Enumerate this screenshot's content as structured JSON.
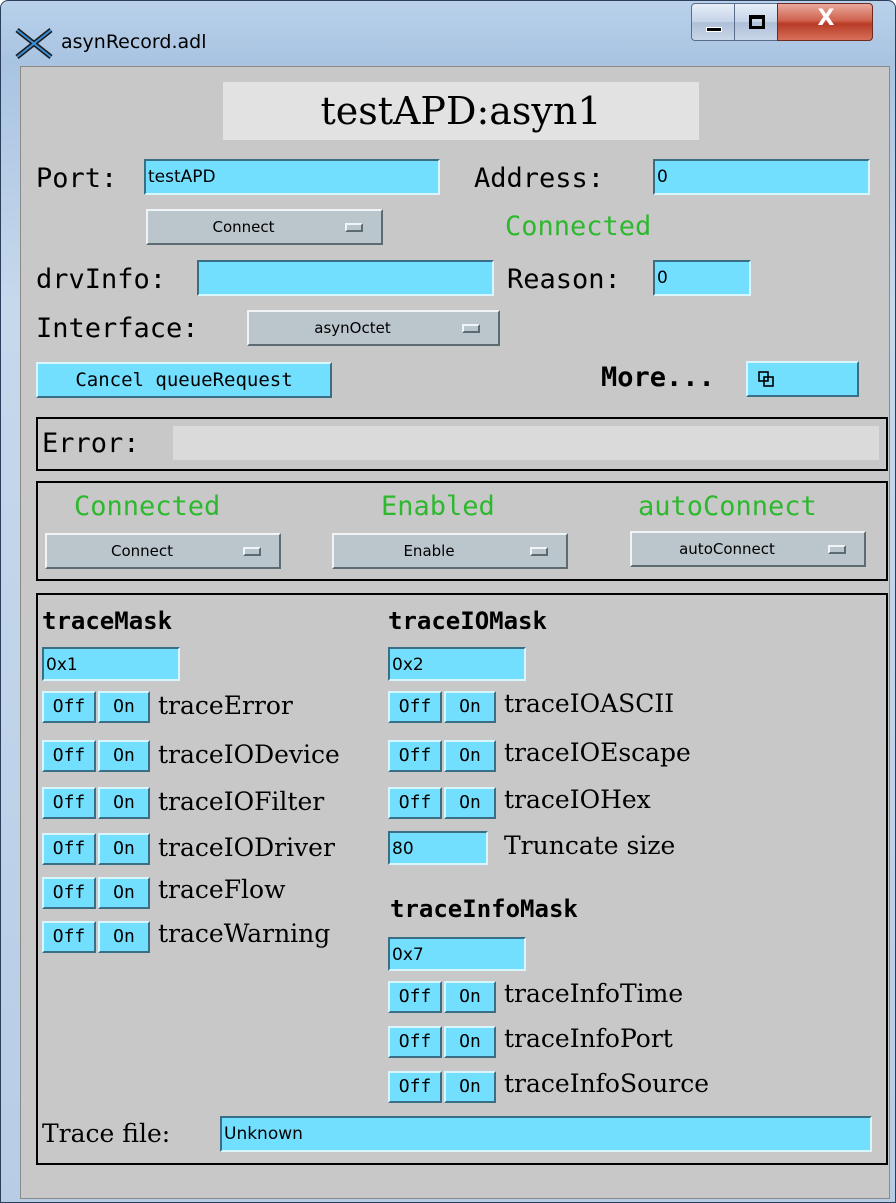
{
  "window": {
    "title": "asynRecord.adl",
    "close_glyph": "X",
    "colors": {
      "field": "#73dfff",
      "background": "#c8c8c8",
      "status_green": "#2eb82e",
      "menu": "#bac6cc"
    }
  },
  "record": {
    "name": "testAPD:asyn1"
  },
  "port": {
    "label": "Port:",
    "value": "testAPD"
  },
  "address": {
    "label": "Address:",
    "value": "0"
  },
  "connect_menu": {
    "value": "Connect"
  },
  "connection_status": "Connected",
  "drvinfo": {
    "label": "drvInfo:",
    "value": ""
  },
  "reason": {
    "label": "Reason:",
    "value": "0"
  },
  "interface": {
    "label": "Interface:",
    "value": "asynOctet"
  },
  "cancel_button": "Cancel queueRequest",
  "more": {
    "label": "More...",
    "icon": "related-display-icon"
  },
  "error": {
    "label": "Error:",
    "value": ""
  },
  "status_panel": {
    "connected": {
      "status": "Connected",
      "menu": "Connect"
    },
    "enabled": {
      "status": "Enabled",
      "menu": "Enable"
    },
    "autoconnect": {
      "status": "autoConnect",
      "menu": "autoConnect"
    }
  },
  "trace_mask": {
    "header": "traceMask",
    "value": "0x1",
    "items": [
      {
        "off": "Off",
        "on": "On",
        "label": "traceError"
      },
      {
        "off": "Off",
        "on": "On",
        "label": "traceIODevice"
      },
      {
        "off": "Off",
        "on": "On",
        "label": "traceIOFilter"
      },
      {
        "off": "Off",
        "on": "On",
        "label": "traceIODriver"
      },
      {
        "off": "Off",
        "on": "On",
        "label": "traceFlow"
      },
      {
        "off": "Off",
        "on": "On",
        "label": "traceWarning"
      }
    ]
  },
  "trace_io_mask": {
    "header": "traceIOMask",
    "value": "0x2",
    "items": [
      {
        "off": "Off",
        "on": "On",
        "label": "traceIOASCII"
      },
      {
        "off": "Off",
        "on": "On",
        "label": "traceIOEscape"
      },
      {
        "off": "Off",
        "on": "On",
        "label": "traceIOHex"
      }
    ],
    "truncate": {
      "value": "80",
      "label": "Truncate size"
    }
  },
  "trace_info_mask": {
    "header": "traceInfoMask",
    "value": "0x7",
    "items": [
      {
        "off": "Off",
        "on": "On",
        "label": "traceInfoTime"
      },
      {
        "off": "Off",
        "on": "On",
        "label": "traceInfoPort"
      },
      {
        "off": "Off",
        "on": "On",
        "label": "traceInfoSource"
      }
    ]
  },
  "trace_file": {
    "label": "Trace file:",
    "value": "Unknown"
  }
}
